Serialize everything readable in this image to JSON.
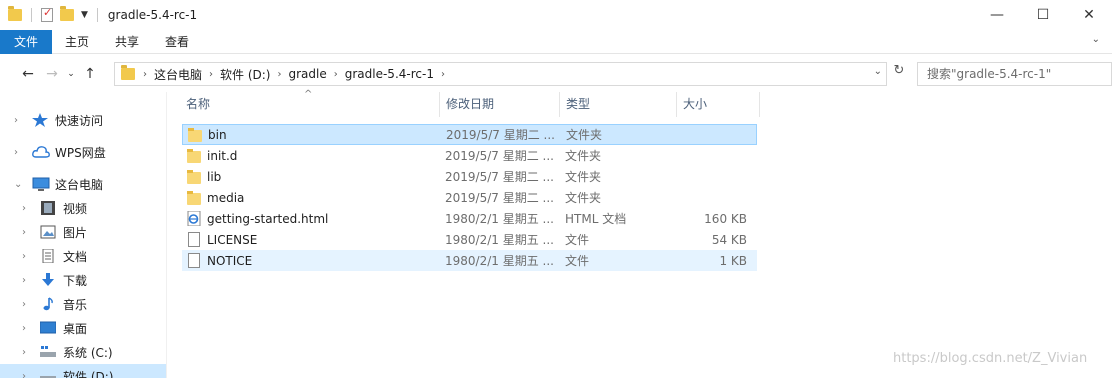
{
  "window": {
    "title": "gradle-5.4-rc-1",
    "controls": {
      "minimize": "—",
      "maximize": "☐",
      "close": "✕"
    }
  },
  "ribbon": {
    "tabs": [
      "文件",
      "主页",
      "共享",
      "查看"
    ],
    "collapse_icon": "chevron-down-icon"
  },
  "address": {
    "crumbs": [
      "这台电脑",
      "软件 (D:)",
      "gradle",
      "gradle-5.4-rc-1"
    ],
    "search_placeholder": "搜索\"gradle-5.4-rc-1\""
  },
  "sidebar": {
    "items": [
      {
        "label": "快速访问",
        "icon": "star-icon"
      },
      {
        "label": "WPS网盘",
        "icon": "cloud-icon"
      },
      {
        "label": "这台电脑",
        "icon": "computer-icon"
      },
      {
        "label": "视频",
        "icon": "video-icon"
      },
      {
        "label": "图片",
        "icon": "pictures-icon"
      },
      {
        "label": "文档",
        "icon": "documents-icon"
      },
      {
        "label": "下载",
        "icon": "download-icon"
      },
      {
        "label": "音乐",
        "icon": "music-icon"
      },
      {
        "label": "桌面",
        "icon": "desktop-icon"
      },
      {
        "label": "系统 (C:)",
        "icon": "drive-icon"
      },
      {
        "label": "软件 (D:)",
        "icon": "drive-icon"
      }
    ]
  },
  "columns": {
    "name": "名称",
    "date": "修改日期",
    "type": "类型",
    "size": "大小"
  },
  "files": [
    {
      "name": "bin",
      "date": "2019/5/7 星期二 ...",
      "type": "文件夹",
      "size": "",
      "icon": "folder-icon"
    },
    {
      "name": "init.d",
      "date": "2019/5/7 星期二 ...",
      "type": "文件夹",
      "size": "",
      "icon": "folder-icon"
    },
    {
      "name": "lib",
      "date": "2019/5/7 星期二 ...",
      "type": "文件夹",
      "size": "",
      "icon": "folder-icon"
    },
    {
      "name": "media",
      "date": "2019/5/7 星期二 ...",
      "type": "文件夹",
      "size": "",
      "icon": "folder-icon"
    },
    {
      "name": "getting-started.html",
      "date": "1980/2/1 星期五 ...",
      "type": "HTML 文档",
      "size": "160 KB",
      "icon": "html-file-icon"
    },
    {
      "name": "LICENSE",
      "date": "1980/2/1 星期五 ...",
      "type": "文件",
      "size": "54 KB",
      "icon": "file-icon"
    },
    {
      "name": "NOTICE",
      "date": "1980/2/1 星期五 ...",
      "type": "文件",
      "size": "1 KB",
      "icon": "file-icon"
    }
  ],
  "watermark": "https://blog.csdn.net/Z_Vivian"
}
